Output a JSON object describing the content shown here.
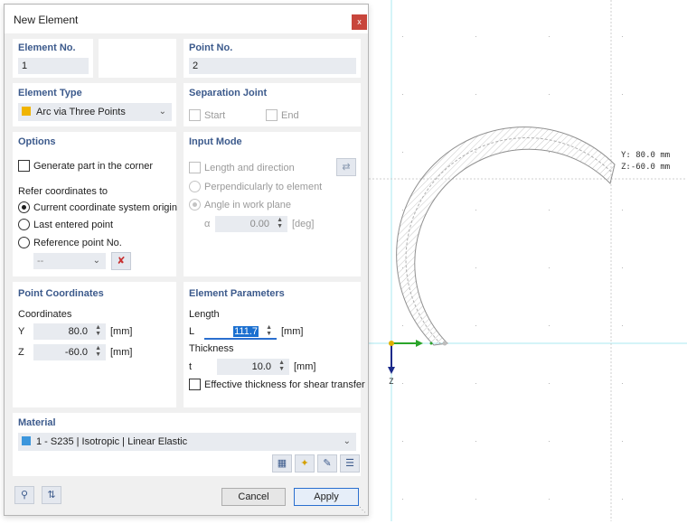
{
  "dialog": {
    "title": "New Element",
    "close_glyph": "x",
    "element_no": {
      "label": "Element No.",
      "value": "1"
    },
    "point_no": {
      "label": "Point No.",
      "value": "2"
    },
    "element_type": {
      "label": "Element Type",
      "value": "Arc via Three Points",
      "color": "#f0b400"
    },
    "separation_joint": {
      "label": "Separation Joint",
      "start": "Start",
      "end": "End"
    },
    "options": {
      "label": "Options",
      "generate_part": "Generate part in the corner",
      "refer_label": "Refer coordinates to",
      "radio_origin": "Current coordinate system origin",
      "radio_last": "Last entered point",
      "radio_reference": "Reference point No.",
      "reference_value": "--"
    },
    "input_mode": {
      "label": "Input Mode",
      "length_direction": "Length and direction",
      "perpendicular": "Perpendicularly to element",
      "angle_plane": "Angle in work plane",
      "alpha_symbol": "α",
      "alpha_value": "0.00",
      "alpha_unit": "[deg]"
    },
    "point_coordinates": {
      "label": "Point Coordinates",
      "coords_label": "Coordinates",
      "y_label": "Y",
      "y_value": "80.0",
      "y_unit": "[mm]",
      "z_label": "Z",
      "z_value": "-60.0",
      "z_unit": "[mm]"
    },
    "element_parameters": {
      "label": "Element Parameters",
      "length_label": "Length",
      "l_symbol": "L",
      "l_value": "111.7",
      "l_unit": "[mm]",
      "thickness_label": "Thickness",
      "t_symbol": "t",
      "t_value": "10.0",
      "t_unit": "[mm]",
      "effective_thickness": "Effective thickness for shear transfer"
    },
    "material": {
      "label": "Material",
      "value": "1 - S235 | Isotropic | Linear Elastic",
      "color": "#3c96dc"
    },
    "buttons": {
      "cancel": "Cancel",
      "apply": "Apply"
    }
  },
  "canvas": {
    "coord_y": "Y: 80.0 mm",
    "coord_z": "Z:-60.0 mm",
    "axis_z": "Z"
  }
}
